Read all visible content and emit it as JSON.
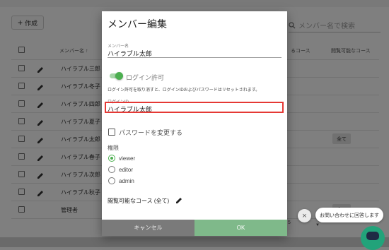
{
  "toolbar": {
    "create_label": "作成",
    "search_placeholder": "メンバー名で検索"
  },
  "table": {
    "col_name": "メンバー名",
    "col_course_partial": "るコース",
    "col_viewable": "閲覧可能なコース",
    "rows": [
      "ハイラブル三郎",
      "ハイラブル冬子",
      "ハイラブル四郎",
      "ハイラブル夏子",
      "ハイラブル太郎",
      "ハイラブル春子",
      "ハイラブル次郎",
      "ハイラブル秋子",
      "管理者"
    ],
    "all_chip": "全て"
  },
  "pager": {
    "digit": "5"
  },
  "dialog": {
    "title": "メンバー編集",
    "member_name_label": "メンバー名",
    "member_name_value": "ハイラブル太郎",
    "login_toggle_label": "ログイン許可",
    "login_helper": "ログイン許可を取り消すと、ログインIDおよびパスワードはリセットされます。",
    "login_id_label": "ログインID",
    "login_id_value": "ハイラブル太郎",
    "change_password_label": "パスワードを変更する",
    "permission_label": "権限",
    "permissions": [
      "viewer",
      "editor",
      "admin"
    ],
    "selected_permission": "viewer",
    "courses_label": "閲覧可能なコース (全て)",
    "cancel_label": "キャンセル",
    "ok_label": "OK"
  },
  "chat": {
    "close_symbol": "×",
    "bubble_text": "お問い合わせに回答します"
  },
  "colors": {
    "accent": "#4caf50",
    "ok_button": "#7fb98a",
    "highlight": "#e53935",
    "chat": "#22a37a"
  }
}
